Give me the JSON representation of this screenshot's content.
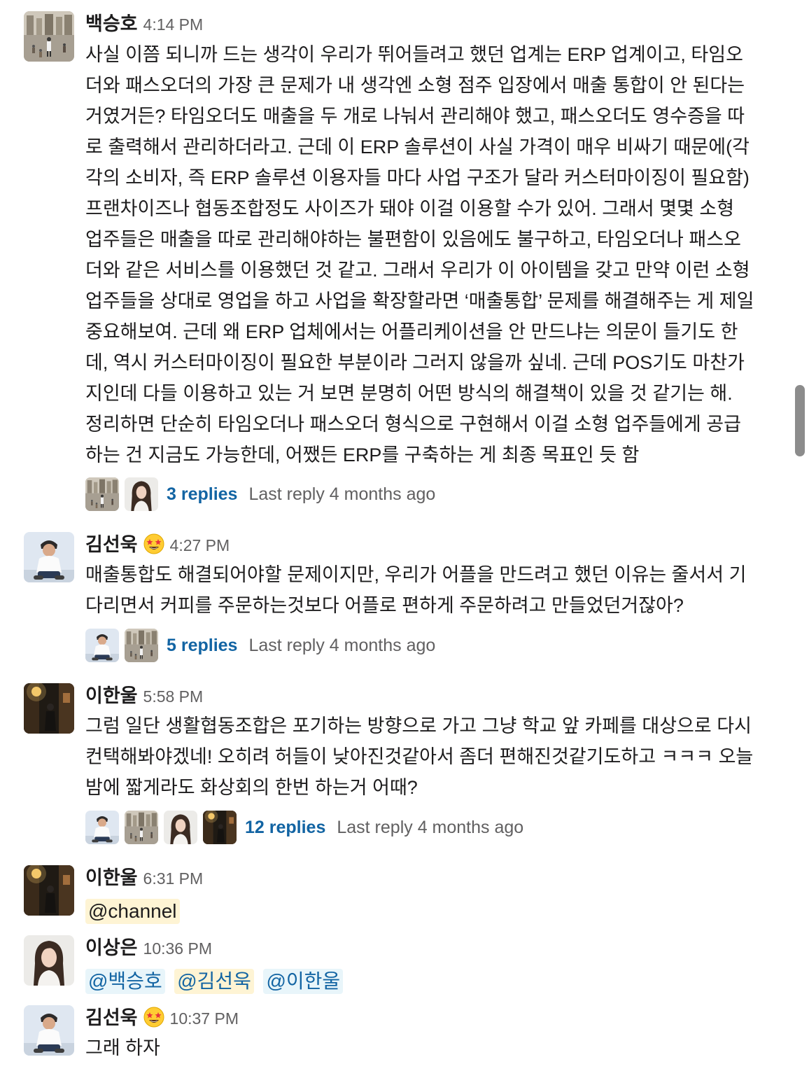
{
  "messages": [
    {
      "author": "백승호",
      "time": "4:14 PM",
      "avatar": "avatar-plaza-photo",
      "lines": [
        "사실 이쯤 되니까 드는 생각이 우리가 뛰어들려고 했던 업계는 ERP 업계이고, 타임오",
        "더와 패스오더의 가장 큰 문제가 내 생각엔 소형 점주 입장에서 매출 통합이 안 된다는",
        "거였거든? 타임오더도 매출을 두 개로 나눠서 관리해야 했고, 패스오더도 영수증을 따",
        "로 출력해서 관리하더라고. 근데 이 ERP 솔루션이 사실 가격이 매우 비싸기 때문에(각",
        "각의 소비자, 즉 ERP 솔루션 이용자들 마다 사업 구조가 달라 커스터마이징이 필요함)",
        "프랜차이즈나 협동조합정도 사이즈가 돼야 이걸 이용할 수가 있어. 그래서 몇몇 소형",
        "업주들은 매출을 따로 관리해야하는 불편함이 있음에도 불구하고, 타임오더나 패스오",
        "더와 같은 서비스를 이용했던 것 같고. 그래서 우리가 이 아이템을 갖고 만약 이런 소형",
        "업주들을 상대로 영업을 하고 사업을 확장할라면 ‘매출통합’ 문제를 해결해주는 게 제일",
        "중요해보여. 근데 왜 ERP 업체에서는 어플리케이션을 안 만드냐는 의문이 들기도 한",
        "데, 역시 커스터마이징이 필요한 부분이라 그러지 않을까 싶네. 근데 POS기도 마찬가",
        "지인데 다들 이용하고 있는 거 보면 분명히 어떤 방식의 해결책이 있을 것 같기는 해.",
        "정리하면 단순히 타임오더나 패스오더 형식으로 구현해서 이걸 소형 업주들에게 공급",
        "하는 건 지금도 가능한데, 어쨌든 ERP를 구축하는 게 최종 목표인 듯 함"
      ],
      "thread": {
        "replies": "3 replies",
        "last_reply": "Last reply 4 months ago"
      }
    },
    {
      "author": "김선욱",
      "time": "4:27 PM",
      "status_emoji": "star-struck-emoji-icon",
      "avatar": "avatar-man-white-shirt",
      "lines": [
        "매출통합도 해결되어야할 문제이지만, 우리가 어플을 만드려고 했던 이유는 줄서서 기",
        "다리면서 커피를 주문하는것보다 어플로 편하게 주문하려고 만들었던거잖아?"
      ],
      "thread": {
        "replies": "5 replies",
        "last_reply": "Last reply 4 months ago"
      }
    },
    {
      "author": "이한울",
      "time": "5:58 PM",
      "avatar": "avatar-night-street",
      "lines": [
        "그럼 일단 생활협동조합은 포기하는 방향으로 가고 그냥 학교 앞 카페를 대상으로 다시",
        "컨택해봐야겠네! 오히려 허들이 낮아진것같아서 좀더 편해진것같기도하고 ㅋㅋㅋ 오늘",
        "밤에 짧게라도 화상회의 한번 하는거 어때?"
      ],
      "thread": {
        "replies": "12 replies",
        "last_reply": "Last reply 4 months ago"
      }
    },
    {
      "author": "이한울",
      "time": "6:31 PM",
      "avatar": "avatar-night-street",
      "mentions": [
        "@channel"
      ]
    },
    {
      "author": "이상은",
      "time": "10:36 PM",
      "avatar": "avatar-woman-portrait",
      "mentions": [
        "@백승호",
        "@김선욱",
        "@이한울"
      ]
    },
    {
      "author": "김선욱",
      "time": "10:37 PM",
      "status_emoji": "star-struck-emoji-icon",
      "avatar": "avatar-man-white-shirt",
      "lines": [
        "그래 하자"
      ]
    }
  ]
}
